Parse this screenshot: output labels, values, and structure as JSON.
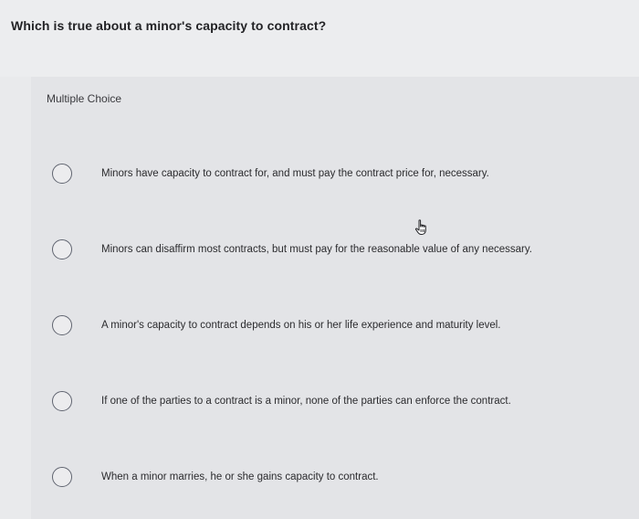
{
  "question": {
    "text": "Which is true about a minor's capacity to contract?"
  },
  "choice_type": "Multiple Choice",
  "options": [
    {
      "label": "Minors have capacity to contract for, and must pay the contract price for, necessary.",
      "selected": false
    },
    {
      "label": "Minors can disaffirm most contracts, but must pay for the reasonable value of any necessary.",
      "selected": false
    },
    {
      "label": "A minor's capacity to contract depends on his or her life experience and maturity level.",
      "selected": false
    },
    {
      "label": "If one of the parties to a contract is a minor, none of the parties can enforce the contract.",
      "selected": false
    },
    {
      "label": "When a minor marries, he or she gains capacity to contract.",
      "selected": false
    }
  ],
  "icons": {
    "radio": "radio-unselected-icon",
    "cursor": "hand-pointer-cursor-icon"
  },
  "colors": {
    "background": "#e9eaec",
    "text": "#2b2b2e",
    "radio_border": "#606470"
  }
}
